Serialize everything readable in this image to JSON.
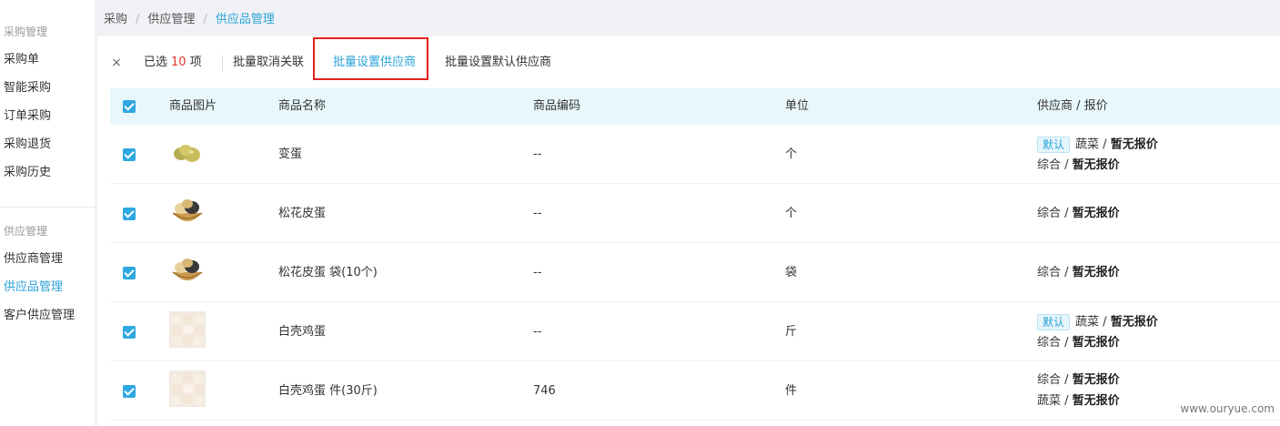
{
  "sidebar": {
    "group1_title": "采购管理",
    "group1_items": [
      "采购单",
      "智能采购",
      "订单采购",
      "采购退货",
      "采购历史"
    ],
    "group2_title": "供应管理",
    "group2_items": [
      "供应商管理",
      "供应品管理",
      "客户供应管理"
    ]
  },
  "breadcrumb": [
    "采购",
    "供应管理",
    "供应品管理"
  ],
  "toolbar": {
    "close_glyph": "×",
    "selected_prefix": "已选",
    "selected_count": "10",
    "selected_suffix": "项",
    "unlink_label": "批量取消关联",
    "set_supplier_label": "批量设置供应商",
    "set_default_label": "批量设置默认供应商"
  },
  "table": {
    "headers": {
      "image": "商品图片",
      "name": "商品名称",
      "code": "商品编码",
      "unit": "单位",
      "supplier": "供应商 / 报价"
    },
    "default_tag": "默认",
    "rows": [
      {
        "name": "变蛋",
        "code": "--",
        "unit": "个",
        "suppliers": [
          {
            "default": true,
            "name": "蔬菜",
            "sep": " / ",
            "price": "暂无报价"
          },
          {
            "default": false,
            "name": "综合",
            "sep": " / ",
            "price": "暂无报价"
          }
        ]
      },
      {
        "name": "松花皮蛋",
        "code": "--",
        "unit": "个",
        "suppliers": [
          {
            "default": false,
            "name": "综合",
            "sep": " / ",
            "price": "暂无报价"
          }
        ]
      },
      {
        "name": "松花皮蛋 袋(10个)",
        "code": "--",
        "unit": "袋",
        "suppliers": [
          {
            "default": false,
            "name": "综合",
            "sep": " / ",
            "price": "暂无报价"
          }
        ]
      },
      {
        "name": "白壳鸡蛋",
        "code": "--",
        "unit": "斤",
        "suppliers": [
          {
            "default": true,
            "name": "蔬菜",
            "sep": " / ",
            "price": "暂无报价"
          },
          {
            "default": false,
            "name": "综合",
            "sep": " / ",
            "price": "暂无报价"
          }
        ]
      },
      {
        "name": "白壳鸡蛋 件(30斤)",
        "code": "746",
        "unit": "件",
        "suppliers": [
          {
            "default": false,
            "name": "综合",
            "sep": " / ",
            "price": "暂无报价"
          },
          {
            "default": false,
            "name": "蔬菜",
            "sep": " / ",
            "price": "暂无报价"
          }
        ]
      }
    ]
  },
  "watermark": "www.ouryue.com",
  "colors": {
    "accent": "#29a3d8",
    "highlight_box": "#e3201b",
    "count": "#e2342b",
    "header_bg": "#e8f7fb"
  }
}
